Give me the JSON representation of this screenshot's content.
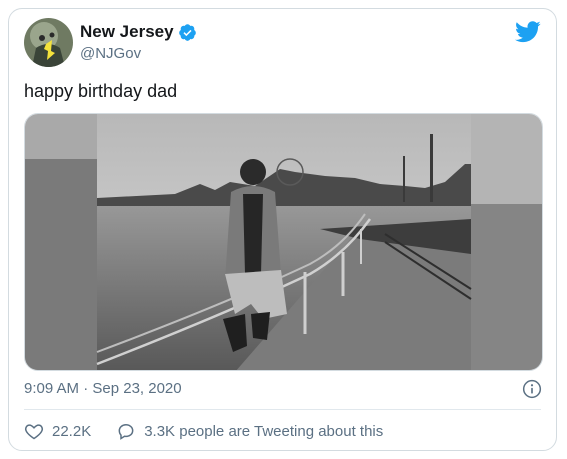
{
  "tweet": {
    "author": {
      "name": "New Jersey",
      "handle": "@NJGov",
      "verified": true
    },
    "text": "happy birthday dad",
    "timestamp": "9:09 AM · Sep 23, 2020",
    "likes": "22.2K",
    "conversation": "3.3K people are Tweeting about this"
  },
  "icons": {
    "brand": "twitter-bird-icon",
    "verified": "verified-badge-icon",
    "info": "info-icon",
    "like": "heart-icon",
    "reply": "speech-bubble-icon"
  },
  "colors": {
    "brand": "#1da1f2",
    "text": "#14171a",
    "secondary": "#5b7083"
  }
}
